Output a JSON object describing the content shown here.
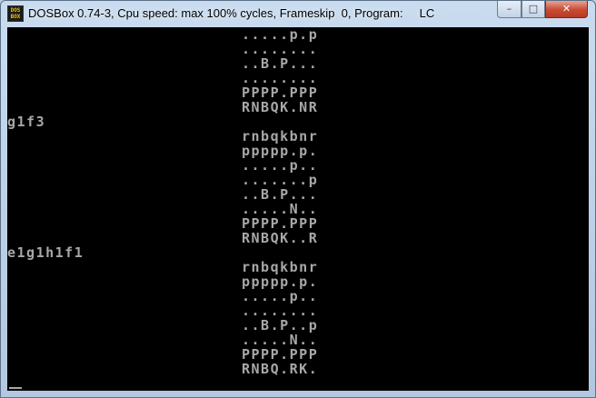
{
  "window": {
    "title": "DOSBox 0.74-3, Cpu speed: max 100% cycles, Frameskip  0, Program:     LC",
    "icon_label": "DOS BOX",
    "icon": "dosbox-app-icon",
    "buttons": {
      "minimize_glyph": "–",
      "maximize_glyph": "□",
      "close_glyph": "✕"
    }
  },
  "console": {
    "text_color": "#a8a8a8",
    "background": "#000000",
    "lines": [
      ".....p.p",
      "........",
      "..B.P...",
      "........",
      "PPPP.PPP",
      "RNBQK.NR",
      "g1f3",
      "rnbqkbnr",
      "ppppp.p.",
      ".....p..",
      ".......p",
      "..B.P...",
      ".....N..",
      "PPPP.PPP",
      "RNBQK..R",
      "e1g1h1f1",
      "rnbqkbnr",
      "ppppp.p.",
      ".....p..",
      "........",
      "..B.P..p",
      ".....N..",
      "PPPP.PPP",
      "RNBQ.RK."
    ]
  }
}
